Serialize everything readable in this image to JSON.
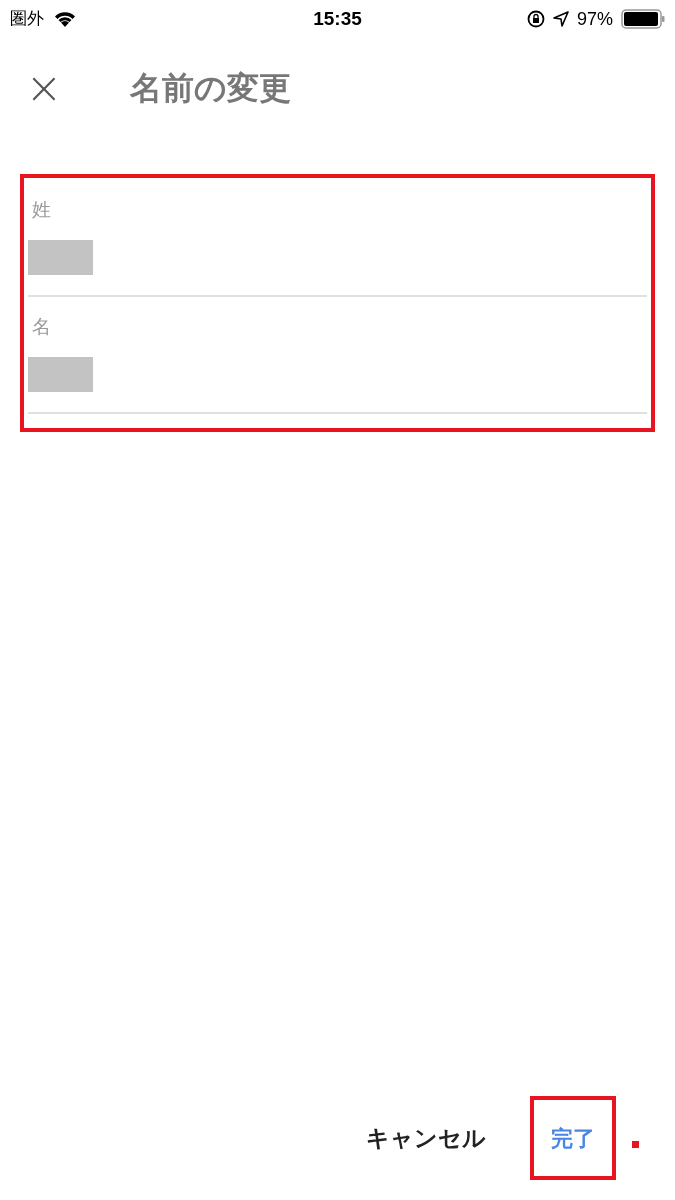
{
  "status_bar": {
    "carrier": "圏外",
    "time": "15:35",
    "battery": "97%"
  },
  "header": {
    "close_icon": "×",
    "title": "名前の変更"
  },
  "fields": [
    {
      "label": "姓"
    },
    {
      "label": "名"
    }
  ],
  "buttons": [
    {
      "label": "キャンセル",
      "kind": "plain"
    },
    {
      "label": "完了",
      "kind": "primary"
    }
  ]
}
